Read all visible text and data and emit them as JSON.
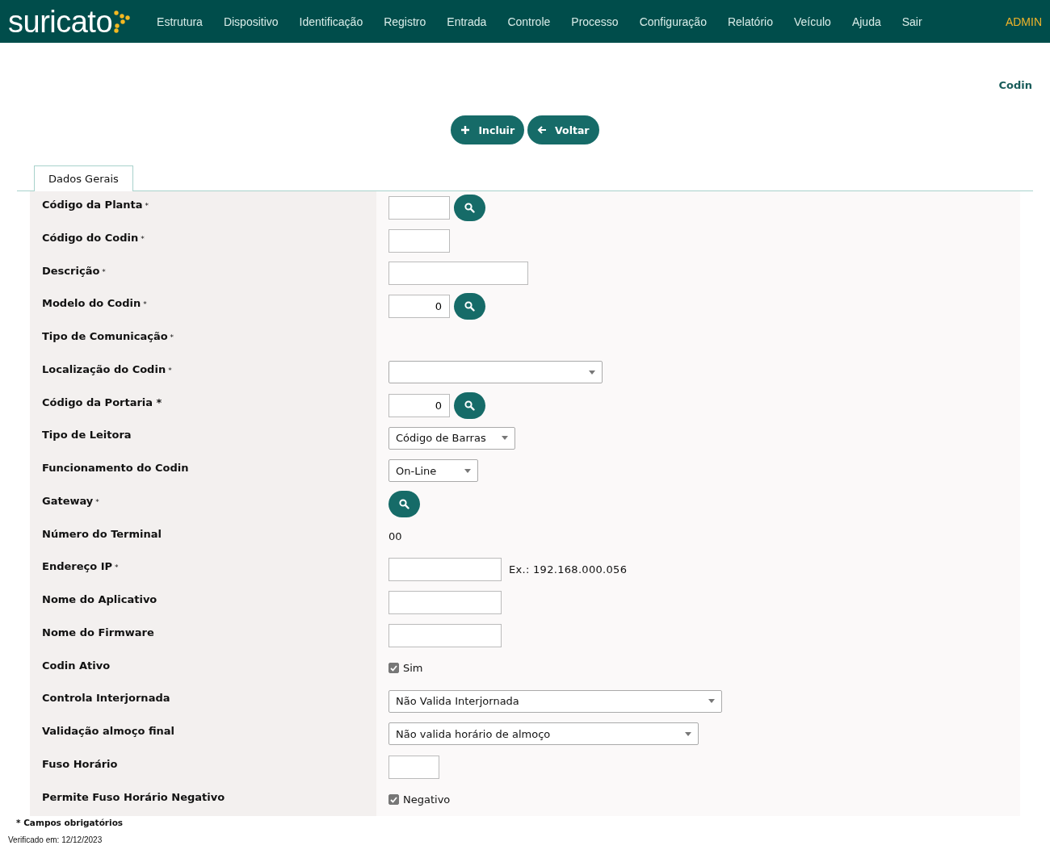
{
  "navbar": {
    "logo": "suricato",
    "menu": [
      "Estrutura",
      "Dispositivo",
      "Identificação",
      "Registro",
      "Entrada",
      "Controle",
      "Processo",
      "Configuração",
      "Relatório",
      "Veículo",
      "Ajuda",
      "Sair"
    ],
    "user": "ADMIN"
  },
  "page_title": "Codin",
  "actions": [
    {
      "kind": "add",
      "label": "Incluir"
    },
    {
      "kind": "back",
      "label": "Voltar"
    }
  ],
  "tabs": [
    {
      "label": "Dados Gerais",
      "selected": true
    }
  ],
  "fields": [
    {
      "label": "Código da Planta",
      "asterisk": "*",
      "kind": "lookup"
    },
    {
      "label": "Código do Codin",
      "asterisk": "*",
      "kind": "input"
    },
    {
      "label": "Descrição",
      "asterisk": "*",
      "kind": "input"
    },
    {
      "label": "Modelo do Codin",
      "asterisk": "*",
      "kind": "lookup",
      "value": "0"
    },
    {
      "label": "Tipo de Comunicação",
      "asterisk": "*",
      "kind": "empty"
    },
    {
      "label": "Localização do Codin",
      "asterisk": "*",
      "kind": "select"
    },
    {
      "label": "Código da Portaria *",
      "kind": "lookup",
      "value": "0"
    },
    {
      "label": "Tipo de Leitora",
      "kind": "select",
      "value": "Código de Barras"
    },
    {
      "label": "Funcionamento do Codin",
      "kind": "select",
      "value": "On-Line"
    },
    {
      "label": "Gateway",
      "asterisk": "*",
      "kind": "search"
    },
    {
      "label": "Número do Terminal",
      "kind": "text",
      "value": "00"
    },
    {
      "label": "Endereço IP",
      "asterisk": "*",
      "kind": "input",
      "hint": "Ex.: 192.168.000.056"
    },
    {
      "label": "Nome do Aplicativo",
      "kind": "input"
    },
    {
      "label": "Nome do Firmware",
      "kind": "input"
    },
    {
      "label": "Codin Ativo",
      "kind": "checkbox",
      "checked": true,
      "option": "Sim"
    },
    {
      "label": "Controla Interjornada",
      "kind": "select",
      "value": "Não Valida Interjornada"
    },
    {
      "label": "Validação almoço final",
      "kind": "select",
      "value": "Não valida horário de almoço"
    },
    {
      "label": "Fuso Horário",
      "kind": "input"
    },
    {
      "label": "Permite Fuso Horário Negativo",
      "kind": "checkbox",
      "checked": true,
      "option": "Negativo"
    }
  ],
  "footnote": "* Campos obrigatórios",
  "verified": "Verificado em: 12/12/2023"
}
